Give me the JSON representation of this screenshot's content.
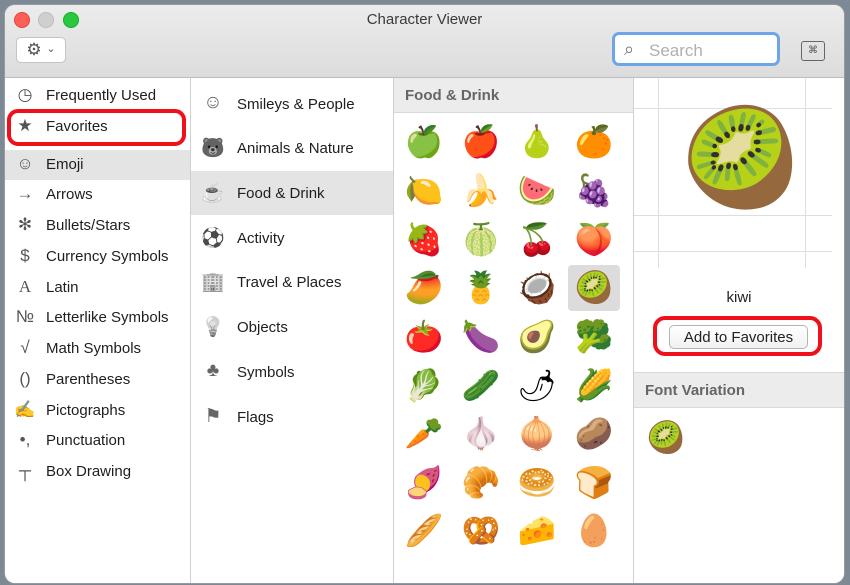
{
  "window": {
    "title": "Character Viewer"
  },
  "toolbar": {
    "gear_icon": "⚙",
    "chevron_icon": "⌄",
    "search_placeholder": "Search",
    "search_glass": "⌕",
    "keyboard_icon": "⌘"
  },
  "categories": [
    {
      "icon": "◷",
      "label": "Frequently Used"
    },
    {
      "icon": "★",
      "label": "Favorites"
    },
    {
      "icon": "☺",
      "label": "Emoji"
    },
    {
      "icon": "→",
      "label": "Arrows"
    },
    {
      "icon": "✻",
      "label": "Bullets/Stars"
    },
    {
      "icon": "$",
      "label": "Currency Symbols"
    },
    {
      "icon": "A",
      "label": "Latin"
    },
    {
      "icon": "№",
      "label": "Letterlike Symbols"
    },
    {
      "icon": "√",
      "label": "Math Symbols"
    },
    {
      "icon": "()",
      "label": "Parentheses"
    },
    {
      "icon": "✍",
      "label": "Pictographs"
    },
    {
      "icon": "•,",
      "label": "Punctuation"
    },
    {
      "icon": "┬",
      "label": "Box Drawing"
    }
  ],
  "emoji_groups": [
    {
      "icon": "☺",
      "label": "Smileys & People"
    },
    {
      "icon": "🐻",
      "label": "Animals & Nature"
    },
    {
      "icon": "☕",
      "label": "Food & Drink"
    },
    {
      "icon": "⚽",
      "label": "Activity"
    },
    {
      "icon": "🏢",
      "label": "Travel & Places"
    },
    {
      "icon": "💡",
      "label": "Objects"
    },
    {
      "icon": "♣",
      "label": "Symbols"
    },
    {
      "icon": "⚑",
      "label": "Flags"
    }
  ],
  "grid": {
    "heading": "Food & Drink",
    "emojis": [
      "🍏",
      "🍎",
      "🍐",
      "🍊",
      "🍋",
      "🍌",
      "🍉",
      "🍇",
      "🍓",
      "🍈",
      "🍒",
      "🍑",
      "🥭",
      "🍍",
      "🥥",
      "🥝",
      "🍅",
      "🍆",
      "🥑",
      "🥦",
      "🥬",
      "🥒",
      "🌶",
      "🌽",
      "🥕",
      "🧄",
      "🧅",
      "🥔",
      "🍠",
      "🥐",
      "🥯",
      "🍞",
      "🥖",
      "🥨",
      "🧀",
      "🥚"
    ]
  },
  "detail": {
    "preview": "🥝",
    "name": "kiwi",
    "add_label": "Add to Favorites",
    "font_variation_heading": "Font Variation",
    "variations": [
      "🥝"
    ]
  },
  "colors": {
    "highlight": "#f0101a",
    "selection": "#e4e4e4",
    "search_ring": "#6ea5e8"
  }
}
